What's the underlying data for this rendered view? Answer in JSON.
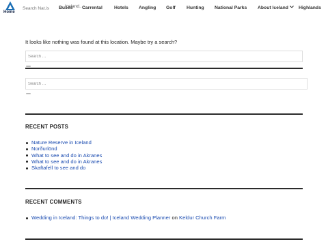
{
  "header": {
    "logo_label": "Home",
    "search_placeholder": "Search Nat.is",
    "overlay_text": "Iceland...",
    "nav": [
      {
        "label": "Buses"
      },
      {
        "label": "Carrental"
      },
      {
        "label": "Hotels"
      },
      {
        "label": "Angling"
      },
      {
        "label": "Golf"
      },
      {
        "label": "Hunting"
      },
      {
        "label": "National Parks"
      },
      {
        "label": "About Iceland"
      },
      {
        "label": "Highlands"
      }
    ]
  },
  "main": {
    "not_found_text": "It looks like nothing was found at this location. Maybe try a search?",
    "search1_placeholder": "Search …",
    "search2_placeholder": "Search …"
  },
  "recent_posts": {
    "title": "RECENT POSTS",
    "items": [
      {
        "label": "Nature Reserve in Iceland"
      },
      {
        "label": "Norðurlönd"
      },
      {
        "label": "What to see and do in Akranes"
      },
      {
        "label": "What to see and do in Akranes"
      },
      {
        "label": "Skaftafell to see and do"
      }
    ]
  },
  "recent_comments": {
    "title": "RECENT COMMENTS",
    "items": [
      {
        "author": "Wedding in Iceland: Things to do! | Iceland Wedding Planner",
        "connector": "on",
        "post": "Keldur Church Farm"
      }
    ]
  },
  "colors": {
    "link": "#1a4bb0",
    "rule": "#2b2b2b",
    "logo": "#1b6fb5"
  }
}
